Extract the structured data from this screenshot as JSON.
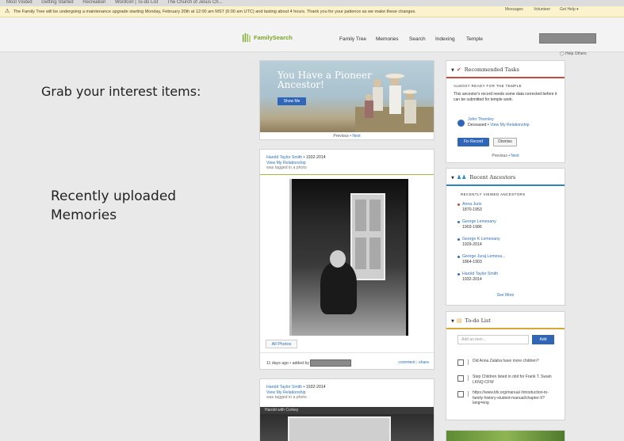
{
  "bookmarks": [
    "Most Visited",
    "Getting Started",
    "Recreation",
    "WordGirl | To-do List",
    "The Church of Jesus Ch..."
  ],
  "alert": "The Family Tree will be undergoing a maintenance upgrade starting Monday, February 20th at 12:00 am MST (6:00 am UTC) and lasting about 4 hours. Thank you for your patience as we make these changes.",
  "header": {
    "utils": [
      "Messages",
      "Volunteer",
      "Get Help ▾"
    ],
    "logo": "FamilySearch",
    "nav": [
      "Family Tree",
      "Memories",
      "Search",
      "Indexing",
      "Temple"
    ],
    "help": "Help Others"
  },
  "side_labels": {
    "grab": "Grab your interest items:",
    "recent_line1": "Recently uploaded",
    "recent_line2": "Memories"
  },
  "promo": {
    "title": "You Have a Pioneer Ancestor!",
    "button": "Show Me",
    "pager_prefix": "Previous • ",
    "pager_next": "Next"
  },
  "memory1": {
    "name": "Harold Taylor Smith",
    "dates": " • 1932-2014",
    "relationship": "View My Relationship",
    "tagged": "was tagged in a photo",
    "all_photos": "All Photos",
    "added": "11 days ago • added by",
    "comment": "comment",
    "share": "share"
  },
  "memory2": {
    "name": "Harold Taylor Smith",
    "dates": " • 1932-2014",
    "relationship": "View My Relationship",
    "tagged": "was tagged in a photo",
    "caption": "Harold with Corkey"
  },
  "recommended": {
    "title": "Recommended Tasks",
    "subtitle": "ALMOST READY FOR THE TEMPLE",
    "body": "This ancestor's record needs some data corrected before it can be submitted for temple work.",
    "person_name": "John Thornley",
    "person_status": "Deceased • ",
    "person_link": "View My Relationship",
    "fix": "Fix Record",
    "dismiss": "Dismiss",
    "pager_prefix": "Previous • ",
    "pager_next": "Next"
  },
  "ancestors": {
    "title": "Recent Ancestors",
    "subtitle": "RECENTLY VIEWED ANCESTORS",
    "items": [
      {
        "name": "Anna Juris",
        "dates": "1870-1953",
        "color": "#d0433b"
      },
      {
        "name": "George Lemesany",
        "dates": "1903-1986",
        "color": "#2f6fb8"
      },
      {
        "name": "George K Lemesany",
        "dates": "1929-2014",
        "color": "#2f6fb8"
      },
      {
        "name": "George Juraj Lemesa...",
        "dates": "1864-1903",
        "color": "#2f6fb8"
      },
      {
        "name": "Harold Taylor Smith",
        "dates": "1932-2014",
        "color": "#2f6fb8"
      }
    ],
    "see_more": "See More"
  },
  "todo": {
    "title": "To-do List",
    "placeholder": "Add an item...",
    "add": "Add",
    "items": [
      "Did Anna Zalaha have more children?",
      "Step Children listed in obit for Frank T. Swain LKNQ-CFW",
      "https://www.lds.org/manual /introduction-to-family-history-student-manual/chapter-9?lang=eng"
    ]
  },
  "colors": {
    "accent_blue": "#2f66b8",
    "fs_green": "#7aa52a",
    "alert_bg": "#fbf3cb"
  }
}
